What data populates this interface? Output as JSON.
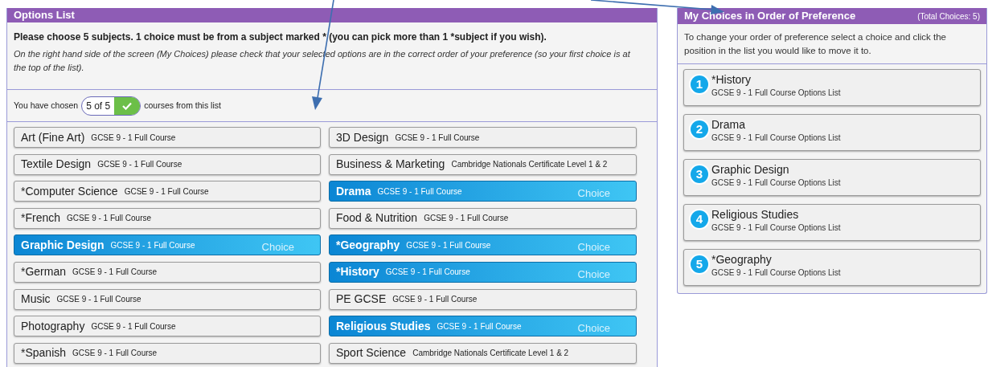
{
  "options_panel": {
    "title": "Options List",
    "instruction": "Please choose 5 subjects. 1 choice must be from a subject marked * (you can pick more than 1 *subject if you wish).",
    "note": "On the right hand side of the screen (My Choices) please check that your selected options are in the correct order of your preference (so your first choice is at the top of the list).",
    "counter_prefix": "You have chosen",
    "counter_value": "5 of 5",
    "counter_complete": true,
    "counter_suffix": "courses from this list",
    "options": [
      {
        "name": "Art (Fine Art)",
        "course": "GCSE 9 - 1 Full Course",
        "selected": false
      },
      {
        "name": "3D Design",
        "course": "GCSE 9 - 1 Full Course",
        "selected": false
      },
      {
        "name": "Textile Design",
        "course": "GCSE 9 - 1 Full Course",
        "selected": false
      },
      {
        "name": "Business & Marketing",
        "course": "Cambridge Nationals Certificate Level 1 & 2",
        "selected": false
      },
      {
        "name": "*Computer Science",
        "course": "GCSE 9 - 1 Full Course",
        "selected": false
      },
      {
        "name": "Drama",
        "course": "GCSE 9 - 1 Full Course",
        "selected": true,
        "watermark": "Choice"
      },
      {
        "name": "*French",
        "course": "GCSE 9 - 1 Full Course",
        "selected": false
      },
      {
        "name": "Food & Nutrition",
        "course": "GCSE 9 - 1 Full Course",
        "selected": false
      },
      {
        "name": "Graphic Design",
        "course": "GCSE 9 - 1 Full Course",
        "selected": true,
        "watermark": "Choice"
      },
      {
        "name": "*Geography",
        "course": "GCSE 9 - 1 Full Course",
        "selected": true,
        "watermark": "Choice"
      },
      {
        "name": "*German",
        "course": "GCSE 9 - 1 Full Course",
        "selected": false
      },
      {
        "name": "*History",
        "course": "GCSE 9 - 1 Full Course",
        "selected": true,
        "watermark": "Choice"
      },
      {
        "name": "Music",
        "course": "GCSE 9 - 1 Full Course",
        "selected": false
      },
      {
        "name": "PE GCSE",
        "course": "GCSE 9 - 1 Full Course",
        "selected": false
      },
      {
        "name": "Photography",
        "course": "GCSE 9 - 1 Full Course",
        "selected": false
      },
      {
        "name": "Religious Studies",
        "course": "GCSE 9 - 1 Full Course",
        "selected": true,
        "watermark": "Choice"
      },
      {
        "name": "*Spanish",
        "course": "GCSE 9 - 1 Full Course",
        "selected": false
      },
      {
        "name": "Sport Science",
        "course": "Cambridge Nationals Certificate Level 1 & 2",
        "selected": false
      }
    ]
  },
  "choices_panel": {
    "title": "My Choices in Order of Preference",
    "total": "(Total Choices: 5)",
    "instruction": "To change your order of preference select a choice and click the position in the list you would like to move it to.",
    "choices": [
      {
        "rank": "1",
        "name": "*History",
        "detail": "GCSE 9 - 1 Full Course Options List"
      },
      {
        "rank": "2",
        "name": "Drama",
        "detail": "GCSE 9 - 1 Full Course Options List"
      },
      {
        "rank": "3",
        "name": "Graphic Design",
        "detail": "GCSE 9 - 1 Full Course Options List"
      },
      {
        "rank": "4",
        "name": "Religious Studies",
        "detail": "GCSE 9 - 1 Full Course Options List"
      },
      {
        "rank": "5",
        "name": "*Geography",
        "detail": "GCSE 9 - 1 Full Course Options List"
      }
    ]
  }
}
